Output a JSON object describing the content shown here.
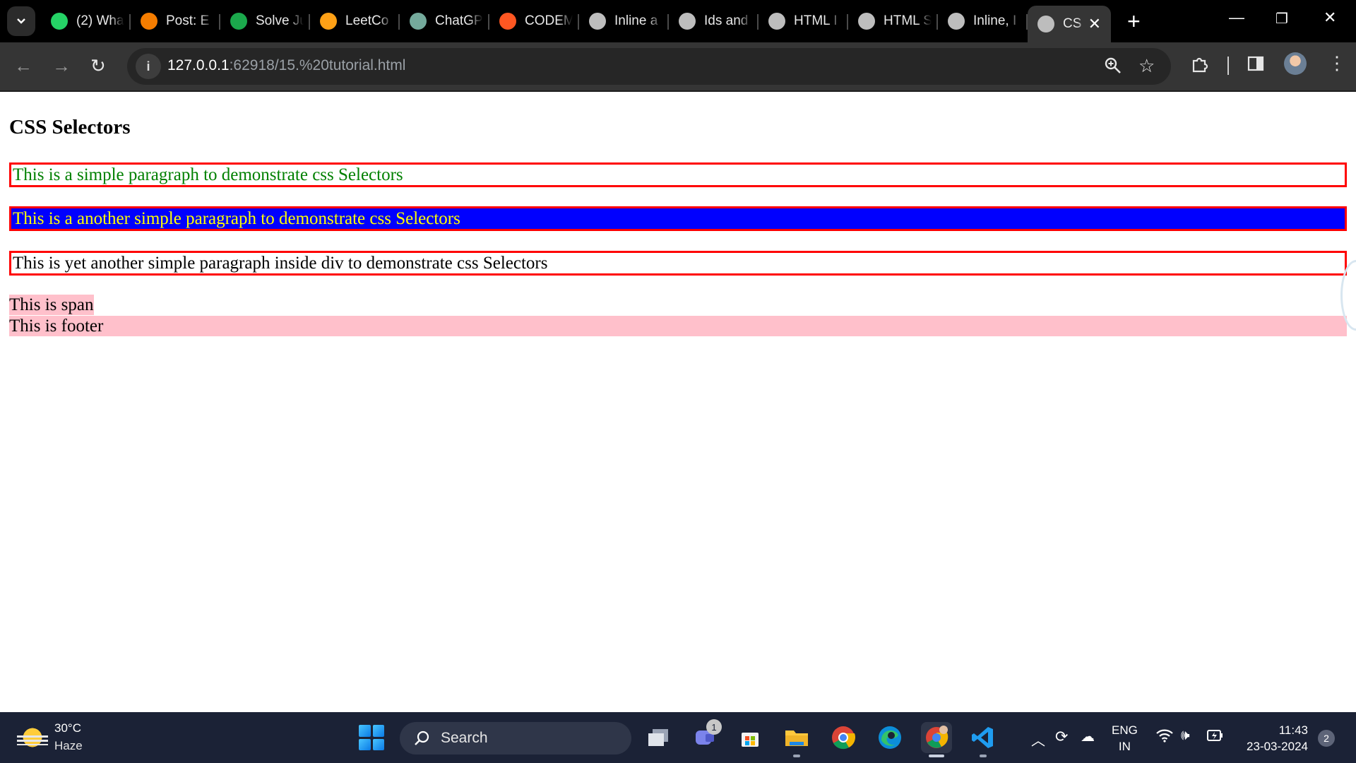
{
  "browser": {
    "tabs": [
      {
        "title": "(2) Wha",
        "icon": "whatsapp-icon",
        "color": "#25d366"
      },
      {
        "title": "Post: E",
        "icon": "blogger-icon",
        "color": "#f57d00"
      },
      {
        "title": "Solve Ju",
        "icon": "hackerrank-icon",
        "color": "#1ba94c"
      },
      {
        "title": "LeetCo",
        "icon": "leetcode-icon",
        "color": "#ffa116"
      },
      {
        "title": "ChatGP",
        "icon": "chatgpt-icon",
        "color": "#74aa9c"
      },
      {
        "title": "CODEM",
        "icon": "blogger-icon",
        "color": "#ff5722"
      },
      {
        "title": "Inline a",
        "icon": "globe-icon",
        "color": "#bdbdbd"
      },
      {
        "title": "Ids and",
        "icon": "globe-icon",
        "color": "#bdbdbd"
      },
      {
        "title": "HTML I",
        "icon": "globe-icon",
        "color": "#bdbdbd"
      },
      {
        "title": "HTML S",
        "icon": "globe-icon",
        "color": "#bdbdbd"
      },
      {
        "title": "Inline, I",
        "icon": "globe-icon",
        "color": "#bdbdbd"
      }
    ],
    "active_tab": {
      "title": "CS",
      "icon": "globe-icon"
    },
    "url_host": "127.0.0.1",
    "url_rest": ":62918/15.%20tutorial.html"
  },
  "page": {
    "title": "CSS Selectors",
    "para1": "This is a simple paragraph to demonstrate css Selectors",
    "para2": "This is a another simple paragraph to demonstrate css Selectors",
    "para3": "This is yet another simple paragraph inside div to demonstrate css Selectors",
    "span_text": "This is span",
    "footer_text": "This is footer",
    "colors": {
      "border": "#ff0000",
      "para1_text": "#008000",
      "para2_bg": "#0000ff",
      "para2_text": "#ffff00",
      "pink_bg": "#ffc0cb"
    }
  },
  "taskbar": {
    "weather_temp": "30°C",
    "weather_cond": "Haze",
    "search_label": "Search",
    "teams_badge": "1",
    "lang_line1": "ENG",
    "lang_line2": "IN",
    "time": "11:43",
    "date": "23-03-2024",
    "notifications": "2"
  }
}
